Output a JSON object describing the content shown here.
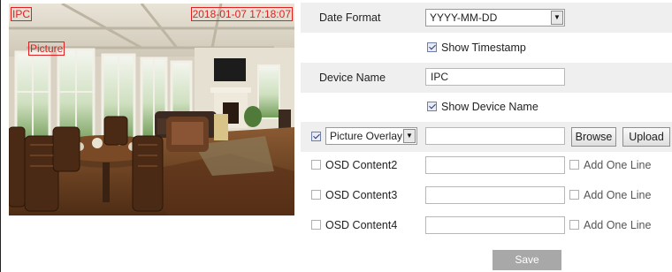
{
  "preview": {
    "osd_name": "IPC",
    "osd_timestamp": "2018-01-07 17:18:07",
    "osd_picture": "Picture"
  },
  "form": {
    "date_format": {
      "label": "Date Format",
      "value": "YYYY-MM-DD"
    },
    "show_timestamp": {
      "label": "Show Timestamp",
      "checked": true
    },
    "device_name": {
      "label": "Device Name",
      "value": "IPC"
    },
    "show_device_name": {
      "label": "Show Device Name",
      "checked": true
    },
    "picture_overlay": {
      "checked": true,
      "select_value": "Picture Overlay",
      "path": "",
      "browse_label": "Browse",
      "upload_label": "Upload"
    },
    "osd2": {
      "label": "OSD Content2",
      "value": "",
      "add_line_label": "Add One Line"
    },
    "osd3": {
      "label": "OSD Content3",
      "value": "",
      "add_line_label": "Add One Line"
    },
    "osd4": {
      "label": "OSD Content4",
      "value": "",
      "add_line_label": "Add One Line"
    },
    "save_label": "Save"
  }
}
